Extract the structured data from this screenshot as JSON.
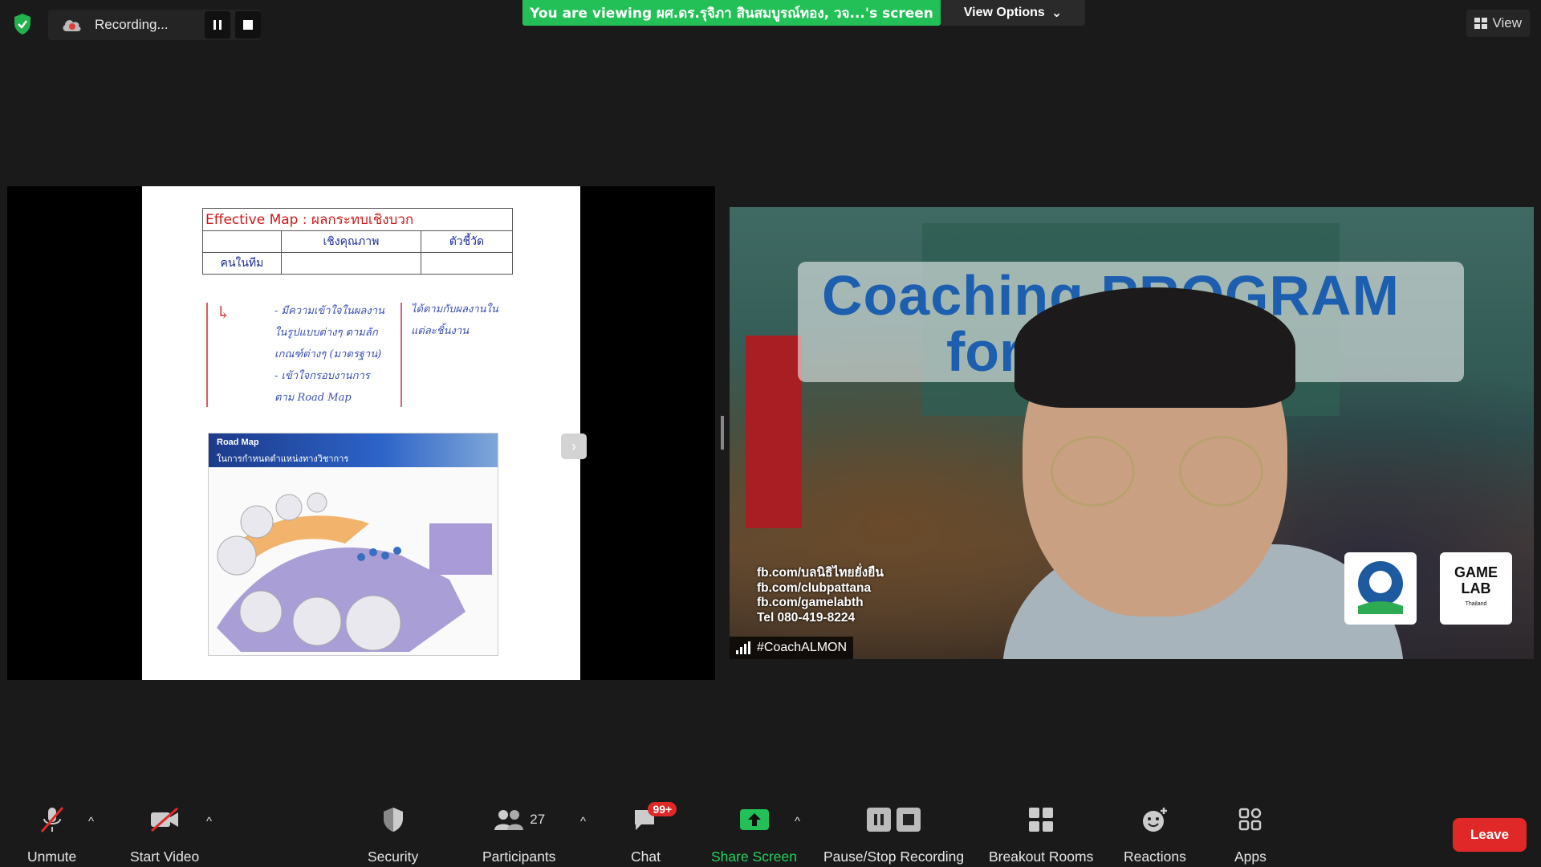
{
  "recording": {
    "status_text": "Recording...",
    "pause_icon": "pause-icon",
    "stop_icon": "stop-icon"
  },
  "banner": {
    "viewing_text": "You are viewing ผศ.ดร.รุจิภา สินสมบูรณ์ทอง, วจ...'s screen",
    "view_options_label": "View Options",
    "view_label": "View"
  },
  "slide": {
    "table_title": "Effective Map : ผลกระทบเชิงบวก",
    "col_quality": "เชิงคุณภาพ",
    "col_indicator": "ตัวชี้วัด",
    "row_team": "คนในทีม",
    "note_left": [
      "- มีความเข้าใจในผลงาน",
      "ในรูปแบบต่างๆ ตามลัก",
      "เกณฑ์ต่างๆ (มาตรฐาน)",
      "- เข้าใจกรอบงานการ",
      "ตาม Road Map"
    ],
    "note_right": [
      "ได้ตามกับผลงานใน",
      "แต่ละชิ้นงาน"
    ],
    "roadmap_title": "Road Map",
    "roadmap_subtitle": "ในการกำหนดตำแหน่งทางวิชาการ"
  },
  "video": {
    "participant_name": "#CoachALMON",
    "title_line1": "Coaching PROGRAM",
    "title_line2": "for Trainer",
    "info": [
      "fb.com/บลนิธิไทยยั่งยืน",
      "fb.com/clubpattana",
      "fb.com/gamelabth",
      "Tel 080-419-8224"
    ],
    "logo_text": "GAME LAB",
    "logo_sub": "Thailand"
  },
  "toolbar": {
    "unmute": "Unmute",
    "start_video": "Start Video",
    "security": "Security",
    "participants": "Participants",
    "participants_count": "27",
    "chat": "Chat",
    "chat_badge": "99+",
    "share_screen": "Share Screen",
    "pause_stop": "Pause/Stop Recording",
    "breakout": "Breakout Rooms",
    "reactions": "Reactions",
    "apps": "Apps",
    "leave": "Leave"
  },
  "colors": {
    "banner_green": "#23c058",
    "share_green": "#23d160",
    "leave_red": "#e02828"
  }
}
